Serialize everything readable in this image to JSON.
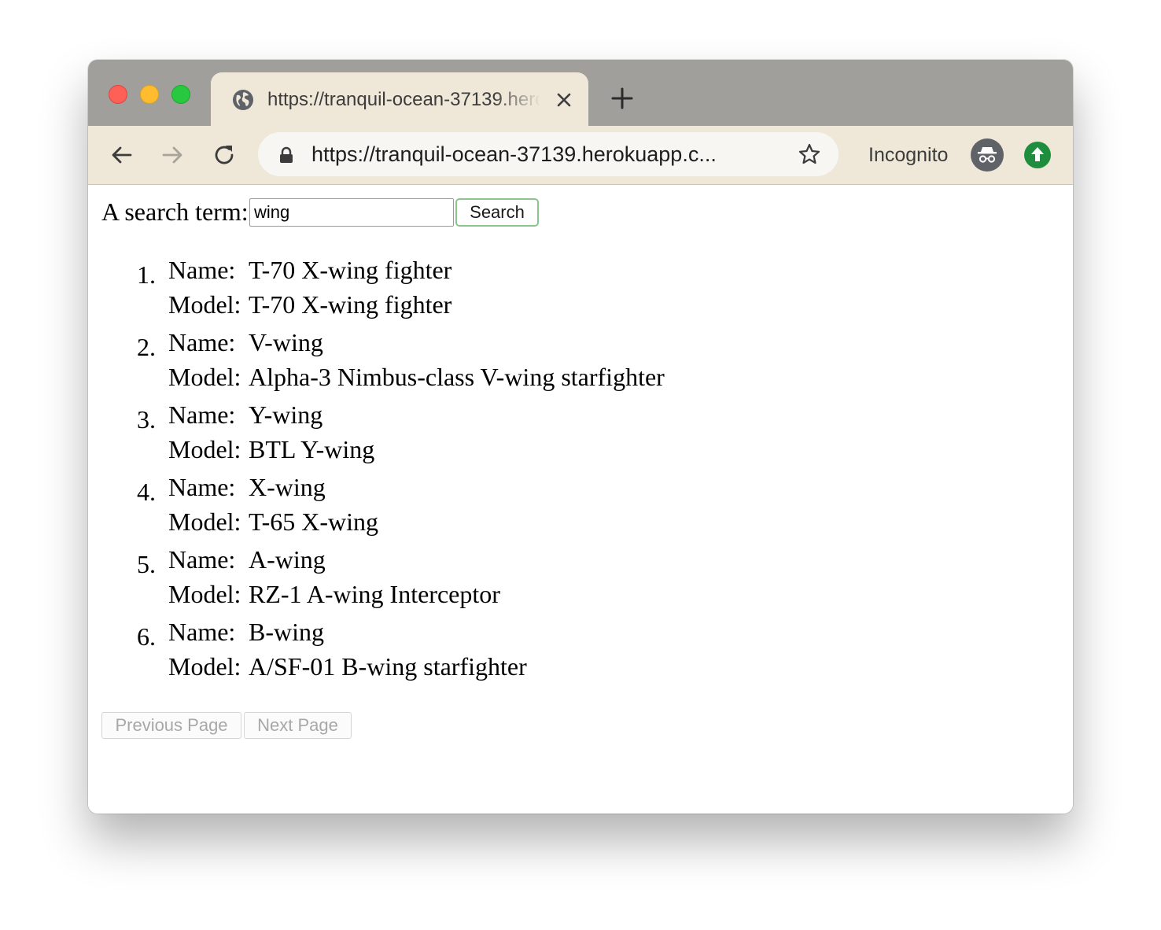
{
  "browser": {
    "tab": {
      "title": "https://tranquil-ocean-37139.herokuapp.com",
      "icon": "globe-icon",
      "close_icon": "close-icon"
    },
    "new_tab_icon": "plus-icon",
    "toolbar": {
      "back_icon": "back-arrow-icon",
      "forward_icon": "forward-arrow-icon",
      "reload_icon": "reload-icon",
      "url": "https://tranquil-ocean-37139.herokuapp.c...",
      "lock_icon": "lock-icon",
      "bookmark_icon": "star-icon",
      "profile_label": "Incognito",
      "profile_icon": "incognito-icon",
      "update_icon": "update-arrow-icon"
    },
    "colors": {
      "titlebar": "#a09f9b",
      "toolbar": "#efe8d8",
      "update_badge": "#1e8e3e",
      "search_button_border": "#8cc58c"
    }
  },
  "page": {
    "search": {
      "label": "A search term:",
      "value": "wing",
      "button_label": "Search"
    },
    "result_labels": {
      "name": "Name:",
      "model": "Model:"
    },
    "results": [
      {
        "number": "1.",
        "name": "T-70 X-wing fighter",
        "model": "T-70 X-wing fighter"
      },
      {
        "number": "2.",
        "name": "V-wing",
        "model": "Alpha-3 Nimbus-class V-wing starfighter"
      },
      {
        "number": "3.",
        "name": "Y-wing",
        "model": "BTL Y-wing"
      },
      {
        "number": "4.",
        "name": "X-wing",
        "model": "T-65 X-wing"
      },
      {
        "number": "5.",
        "name": "A-wing",
        "model": "RZ-1 A-wing Interceptor"
      },
      {
        "number": "6.",
        "name": "B-wing",
        "model": "A/SF-01 B-wing starfighter"
      }
    ],
    "pagination": {
      "previous_label": "Previous Page",
      "next_label": "Next Page",
      "previous_disabled": true,
      "next_disabled": true
    }
  }
}
